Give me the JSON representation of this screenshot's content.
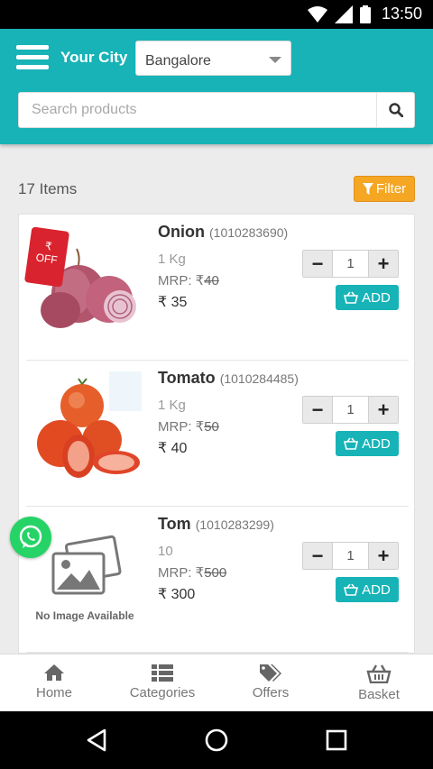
{
  "status_bar": {
    "time": "13:50",
    "icons": [
      "wifi-icon",
      "signal-icon",
      "battery-icon"
    ]
  },
  "header": {
    "city_label": "Your City",
    "city_value": "Bangalore",
    "search_placeholder": "Search products",
    "brand_color": "#17b3b7"
  },
  "list": {
    "count_text": "17 Items",
    "filter_label": "Filter"
  },
  "products": [
    {
      "name": "Onion",
      "code": "(1010283690)",
      "unit": "1 Kg",
      "mrp_label": "MRP: ₹",
      "mrp": "40",
      "price": "₹ 35",
      "qty": "1",
      "add_label": "ADD",
      "tag": {
        "symbol": "₹",
        "text": "OFF"
      }
    },
    {
      "name": "Tomato",
      "code": "(1010284485)",
      "unit": "1 Kg",
      "mrp_label": "MRP: ₹",
      "mrp": "50",
      "price": "₹ 40",
      "qty": "1",
      "add_label": "ADD"
    },
    {
      "name": "Tom",
      "code": "(1010283299)",
      "unit": "10",
      "mrp_label": "MRP: ₹",
      "mrp": "500",
      "price": "₹ 300",
      "qty": "1",
      "add_label": "ADD",
      "placeholder_text": "No Image Available"
    }
  ],
  "bottom_nav": [
    {
      "label": "Home",
      "icon": "home-icon"
    },
    {
      "label": "Categories",
      "icon": "list-icon"
    },
    {
      "label": "Offers",
      "icon": "tags-icon"
    },
    {
      "label": "Basket",
      "icon": "basket-icon"
    }
  ],
  "colors": {
    "accent": "#17b3b7",
    "filter": "#f5a623",
    "offer_tag": "#d9232e",
    "whatsapp": "#25d366"
  }
}
